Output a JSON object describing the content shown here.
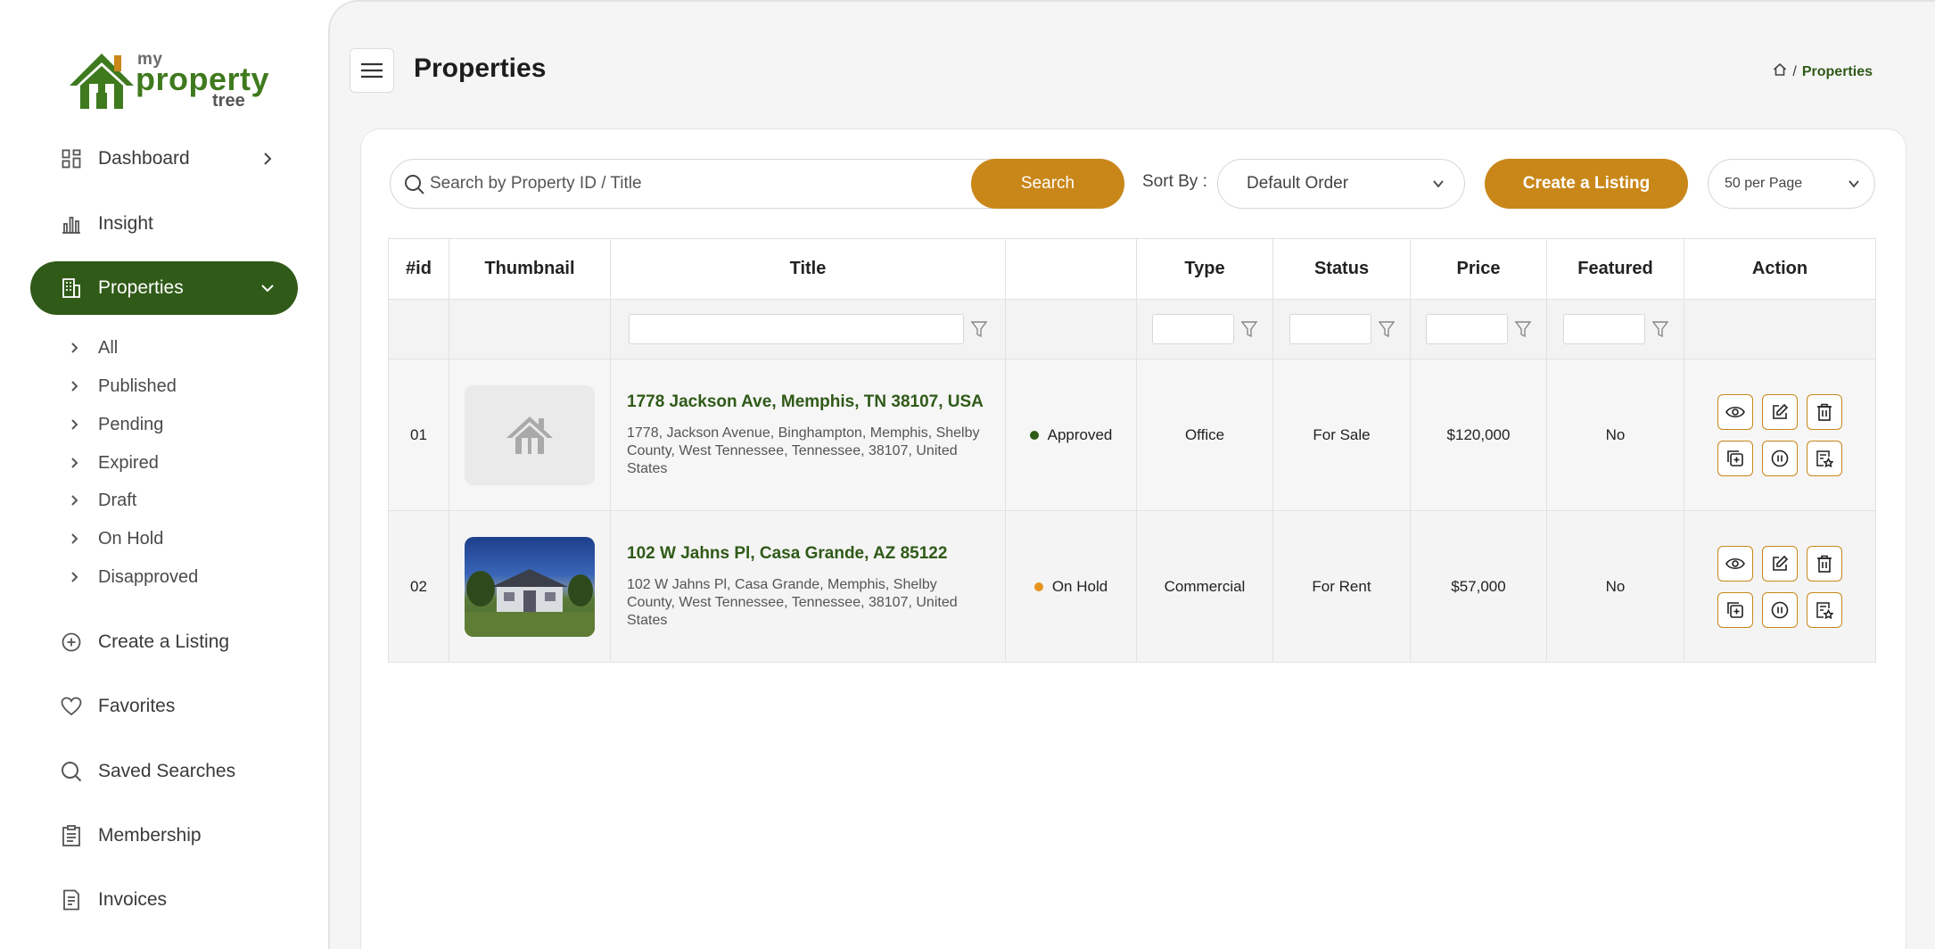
{
  "brand": {
    "logo_my": "my",
    "logo_property": "property",
    "logo_tree": "tree",
    "green": "#2f5a17",
    "gold": "#c98619"
  },
  "sidebar": {
    "items": [
      {
        "label": "Dashboard",
        "icon": "dashboard-icon"
      },
      {
        "label": "Insight",
        "icon": "chart-icon"
      },
      {
        "label": "Properties",
        "icon": "building-icon"
      },
      {
        "label": "Create a Listing",
        "icon": "plus-circle-icon"
      },
      {
        "label": "Favorites",
        "icon": "heart-icon"
      },
      {
        "label": "Saved Searches",
        "icon": "search-icon"
      },
      {
        "label": "Membership",
        "icon": "clipboard-icon"
      },
      {
        "label": "Invoices",
        "icon": "invoice-icon"
      }
    ],
    "property_subitems": [
      "All",
      "Published",
      "Pending",
      "Expired",
      "Draft",
      "On Hold",
      "Disapproved"
    ]
  },
  "header": {
    "title": "Properties",
    "breadcrumb_separator": "/",
    "breadcrumb_current": "Properties"
  },
  "toolbar": {
    "search_placeholder": "Search by Property ID / Title",
    "search_button": "Search",
    "sort_label": "Sort By :",
    "sort_value": "Default Order",
    "create_button": "Create a Listing",
    "per_page_value": "50 per Page"
  },
  "table": {
    "headers": [
      "#id",
      "Thumbnail",
      "Title",
      "",
      "Type",
      "Status",
      "Price",
      "Featured",
      "Action"
    ],
    "rows": [
      {
        "id": "01",
        "title": "1778 Jackson Ave, Memphis, TN 38107, USA",
        "address": "1778, Jackson Avenue, Binghampton, Memphis, Shelby County, West Tennessee, Tennessee, 38107, United States",
        "approval": "Approved",
        "approval_color": "#2f5a17",
        "type": "Office",
        "status": "For Sale",
        "price": "$120,000",
        "featured": "No",
        "thumbnail": "placeholder-house"
      },
      {
        "id": "02",
        "title": "102 W Jahns Pl, Casa Grande, AZ 85122",
        "address": "102 W Jahns Pl, Casa Grande, Memphis, Shelby County, West Tennessee, Tennessee, 38107, United States",
        "approval": "On Hold",
        "approval_color": "#e8951f",
        "type": "Commercial",
        "status": "For Rent",
        "price": "$57,000",
        "featured": "No",
        "thumbnail": "house-photo"
      }
    ],
    "action_icons": [
      "eye-icon",
      "edit-icon",
      "trash-icon",
      "duplicate-icon",
      "pause-icon",
      "document-star-icon"
    ]
  }
}
